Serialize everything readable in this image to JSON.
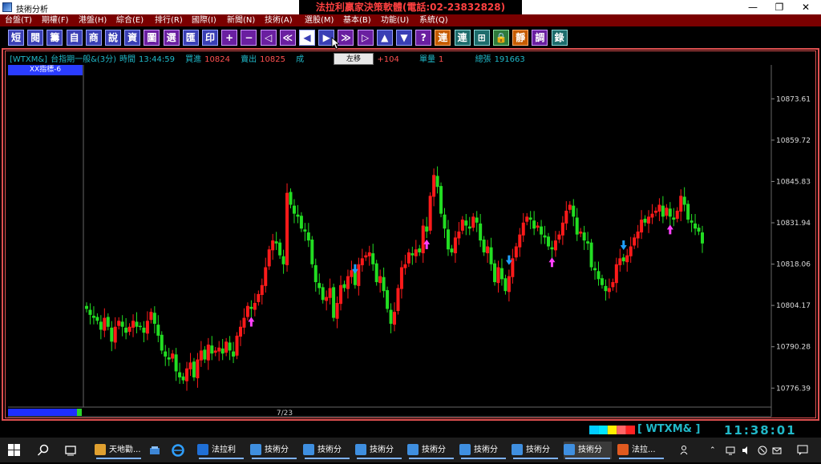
{
  "window": {
    "title": "技術分析",
    "banner": "法拉利贏家決策軟體(電話:02-23832828)",
    "min_label": "—",
    "max_label": "❐",
    "close_label": "✕"
  },
  "menu": [
    "台盤(T)",
    "期權(F)",
    "港盤(H)",
    "綜合(E)",
    "排行(R)",
    "國際(I)",
    "新聞(N)",
    "技術(A)",
    "選股(M)",
    "基本(B)",
    "功能(U)",
    "系統(Q)"
  ],
  "toolbar": {
    "buttons": [
      "短",
      "閱",
      "籌",
      "自",
      "商",
      "說",
      "資",
      "圖",
      "選",
      "匯",
      "印",
      "+",
      "−",
      "◁",
      "≪",
      "◀",
      "▶",
      "≫",
      "▷",
      "▲",
      "▼",
      "?",
      "連",
      "連",
      "⊞",
      "🔒",
      "靜",
      "調",
      "錄"
    ],
    "tooltip": "左移"
  },
  "quote": {
    "symbol": "[WTXM&]",
    "name": "台指期一般&(3分)",
    "time_label": "時間",
    "time": "13:44:59",
    "bid_label": "買進",
    "bid": "10824",
    "ask_label": "賣出",
    "ask": "10825",
    "trade_label": "成",
    "change_label": "漲跌",
    "change": "+104",
    "volume_label": "單量",
    "volume": "1",
    "total_label": "總張",
    "total": "191663"
  },
  "indicator_label": "XX指標-6",
  "chart_data": {
    "type": "candlestick",
    "y_ticks": [
      "10873.61",
      "10859.72",
      "10845.83",
      "10831.94",
      "10818.06",
      "10804.17",
      "10790.28",
      "10776.39"
    ],
    "ylim": [
      10770,
      10885
    ],
    "x_label": "7/23",
    "colors": {
      "up": "#ff1a1a",
      "down": "#22dd22"
    },
    "closes": [
      10803,
      10801,
      10800,
      10799,
      10796,
      10800,
      10797,
      10792,
      10797,
      10799,
      10797,
      10795,
      10797,
      10799,
      10797,
      10797,
      10795,
      10799,
      10802,
      10798,
      10794,
      10789,
      10787,
      10786,
      10788,
      10782,
      10780,
      10779,
      10783,
      10785,
      10780,
      10786,
      10789,
      10786,
      10791,
      10788,
      10789,
      10790,
      10788,
      10792,
      10789,
      10787,
      10794,
      10797,
      10800,
      10804,
      10803,
      10805,
      10808,
      10811,
      10817,
      10823,
      10826,
      10825,
      10821,
      10818,
      10842,
      10838,
      10835,
      10834,
      10830,
      10829,
      10826,
      10818,
      10812,
      10810,
      10806,
      10807,
      10810,
      10800,
      10805,
      10811,
      10810,
      10814,
      10816,
      10811,
      10818,
      10820,
      10821,
      10822,
      10818,
      10812,
      10814,
      10809,
      10803,
      10798,
      10802,
      10810,
      10817,
      10818,
      10822,
      10821,
      10823,
      10822,
      10831,
      10829,
      10841,
      10848,
      10844,
      10835,
      10830,
      10823,
      10822,
      10827,
      10829,
      10833,
      10831,
      10830,
      10834,
      10832,
      10826,
      10822,
      10824,
      10818,
      10812,
      10817,
      10813,
      10809,
      10814,
      10820,
      10824,
      10828,
      10832,
      10834,
      10833,
      10830,
      10831,
      10828,
      10827,
      10824,
      10823,
      10826,
      10828,
      10832,
      10836,
      10838,
      10834,
      10828,
      10829,
      10826,
      10825,
      10817,
      10816,
      10813,
      10811,
      10809,
      10810,
      10812,
      10818,
      10820,
      10819,
      10821,
      10824,
      10827,
      10829,
      10833,
      10832,
      10834,
      10835,
      10836,
      10838,
      10834,
      10837,
      10834,
      10833,
      10836,
      10841,
      10838,
      10833,
      10832,
      10830,
      10829,
      10825
    ],
    "markers": [
      {
        "i": 46,
        "dir": "up",
        "color": "#ff40ff"
      },
      {
        "i": 75,
        "dir": "down",
        "color": "#1fa0ff"
      },
      {
        "i": 95,
        "dir": "up",
        "color": "#ff40ff"
      },
      {
        "i": 118,
        "dir": "down",
        "color": "#1fa0ff"
      },
      {
        "i": 130,
        "dir": "up",
        "color": "#ff40ff"
      },
      {
        "i": 150,
        "dir": "down",
        "color": "#1fa0ff"
      },
      {
        "i": 163,
        "dir": "up",
        "color": "#ff40ff"
      }
    ]
  },
  "status": {
    "symbol": "[ WTXM&  ]",
    "clock": "11:38:01",
    "colorbar": [
      "#00ccff",
      "#00e5ff",
      "#ffee00",
      "#ff6666",
      "#ff2222"
    ]
  },
  "taskbar": {
    "items": [
      "天地勸...",
      "法拉利",
      "技術分",
      "技術分",
      "技術分",
      "技術分",
      "技術分",
      "技術分",
      "技術分",
      "法拉..."
    ],
    "active_index": 8
  }
}
